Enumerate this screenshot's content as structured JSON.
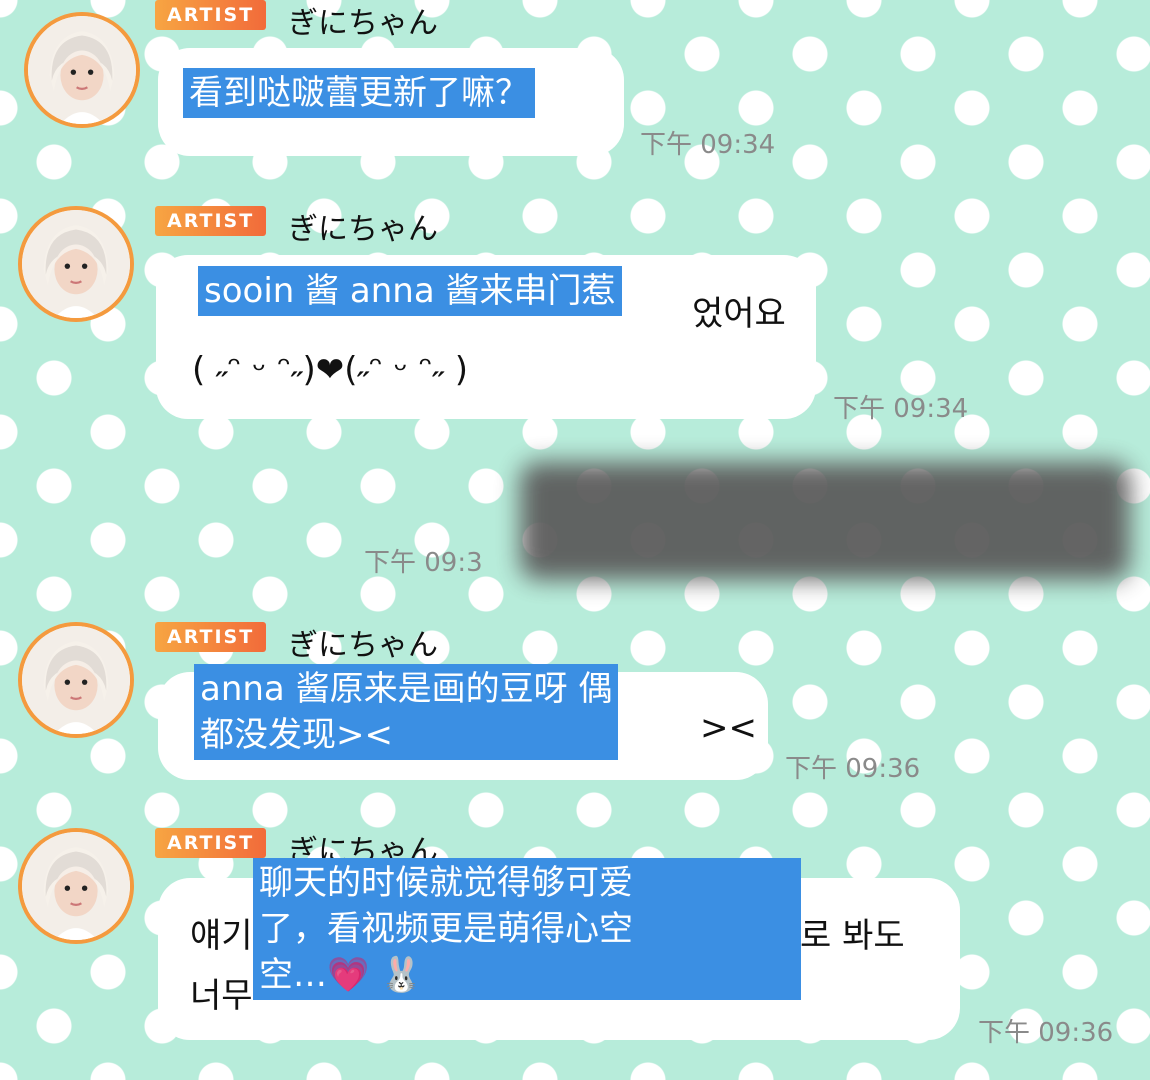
{
  "artist_badge": "ARTIST",
  "sender_name": "ぎにちゃん",
  "messages": [
    {
      "time": "下午 09:34",
      "translation": [
        "看到哒啵蕾更新了嘛？"
      ]
    },
    {
      "time": "下午 09:34",
      "original_end": "었어요",
      "original_line2": "( ˶ᵔ ᵕ ᵔ˶)❤(˶ᵔ ᵕ ᵔ˶ )",
      "translation": [
        "sooin 酱 anna 酱来串门惹"
      ]
    },
    {
      "time": "下午 09:3",
      "outgoing": true
    },
    {
      "time": "下午 09:36",
      "original_end": "><",
      "translation": [
        "anna 酱原来是画的豆呀 偶",
        "都没发现><"
      ]
    },
    {
      "time": "下午 09:36",
      "original_line1_start": "얘기",
      "original_line1_end": "로 봐도",
      "original_line2_start": "너무",
      "translation": [
        "聊天的时候就觉得够可爱",
        "了，看视频更是萌得心空",
        "空…💗 🐰"
      ]
    }
  ]
}
